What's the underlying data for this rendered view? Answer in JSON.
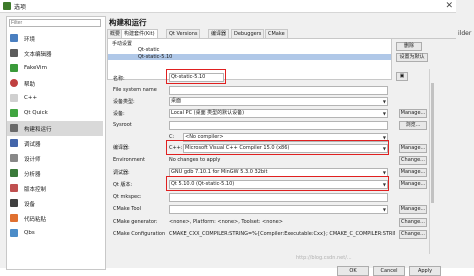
{
  "window": {
    "title": "选项"
  },
  "sidebar": {
    "filter_placeholder": "Filter",
    "items": [
      {
        "label": "环境",
        "icon": "monitor-icon"
      },
      {
        "label": "文本编辑器",
        "icon": "text-editor-icon"
      },
      {
        "label": "FakeVim",
        "icon": "vim-icon"
      },
      {
        "label": "帮助",
        "icon": "help-icon"
      },
      {
        "label": "C++",
        "icon": "cpp-icon"
      },
      {
        "label": "Qt Quick",
        "icon": "qtquick-icon"
      },
      {
        "label": "构建和运行",
        "icon": "build-run-icon"
      },
      {
        "label": "调试器",
        "icon": "debugger-icon"
      },
      {
        "label": "设计师",
        "icon": "designer-icon"
      },
      {
        "label": "分析器",
        "icon": "analyzer-icon"
      },
      {
        "label": "版本控制",
        "icon": "version-control-icon"
      },
      {
        "label": "设备",
        "icon": "devices-icon"
      },
      {
        "label": "代码粘贴",
        "icon": "code-paste-icon"
      },
      {
        "label": "Qbs",
        "icon": "qbs-icon"
      }
    ],
    "selected_index": 6
  },
  "main": {
    "heading": "构建和运行",
    "tabs": [
      {
        "label": "概要"
      },
      {
        "label": "构建套件(Kit)"
      },
      {
        "label": "Qt Versions"
      },
      {
        "label": "编译器"
      },
      {
        "label": "Debuggers"
      },
      {
        "label": "CMake"
      }
    ],
    "active_tab": 1,
    "kit_list": {
      "group": "手动设置",
      "items": [
        "Qt-static",
        "Qt-static-5.10"
      ],
      "selected_index": 1
    },
    "side_buttons": {
      "remove": "删除",
      "set_default": "设置为默认"
    },
    "form": {
      "name_label": "名称:",
      "name_value": "Qt-static-5.10",
      "fs_name_label": "File system name",
      "device_type_label": "设备类型:",
      "device_type_value": "桌面",
      "device_label": "设备:",
      "device_value": "Local PC (桌面 类型的默认设备)",
      "sysroot_label": "Sysroot",
      "compiler_label": "编译器:",
      "compiler_c_label": "C:",
      "compiler_c_value": "<No compiler>",
      "compiler_cpp_label": "C++:",
      "compiler_cpp_value": "Microsoft Visual C++ Compiler 15.0 (x86)",
      "environment_label": "Environment",
      "environment_value": "No changes to apply",
      "debugger_label": "调试器:",
      "debugger_value": "GNU gdb 7.10.1 for MinGW 5.3.0 32bit",
      "qt_version_label": "Qt 版本:",
      "qt_version_value": "Qt 5.10.0 (Qt-static-5.10)",
      "qmlspec_label": "Qt mkspec:",
      "cmake_tool_label": "CMake Tool",
      "cmake_gen_label": "CMake generator:",
      "cmake_gen_value": "<none>, Platform: <none>, Toolset: <none>",
      "cmake_conf_label": "CMake Configuration",
      "cmake_conf_value": "CMAKE_CXX_COMPILER:STRING=%{Compiler:Executable:Cxx}; CMAKE_C_COMPILER:STRING=%{",
      "manage_label": "Manage...",
      "change_label": "Change...",
      "browse_label": "浏览..."
    },
    "dialog_buttons": {
      "ok": "OK",
      "cancel": "Cancel",
      "apply": "Apply"
    }
  },
  "background": {
    "text": "ilder"
  },
  "watermark": "http://blog.csdn.net/..."
}
